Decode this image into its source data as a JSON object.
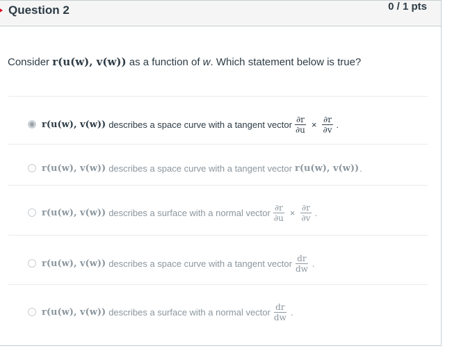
{
  "header": {
    "title": "Question 2",
    "points": "0 / 1 pts"
  },
  "question": {
    "prefix": "Consider",
    "function_expr": "r(u(w), v(w))",
    "suffix_pre": "as a function of",
    "variable": "w",
    "suffix_post": ". Which statement below is true?"
  },
  "options": [
    {
      "expr": "r(u(w), v(w))",
      "text": "describes a space curve with a tangent vector",
      "math_a_num": "∂r",
      "math_a_den": "∂u",
      "operator": "×",
      "math_b_num": "∂r",
      "math_b_den": "∂v",
      "end": "."
    },
    {
      "expr": "r(u(w), v(w))",
      "text": "describes a space curve with a tangent vector",
      "inline_math": "r(u(w), v(w))",
      "end": "."
    },
    {
      "expr": "r(u(w), v(w))",
      "text": "describes a surface with a normal vector",
      "math_a_num": "∂r",
      "math_a_den": "∂u",
      "operator": "×",
      "math_b_num": "∂r",
      "math_b_den": "∂v",
      "end": "."
    },
    {
      "expr": "r(u(w), v(w))",
      "text": "describes a space curve with a tangent vector",
      "math_a_num": "dr",
      "math_a_den": "dw",
      "end": "."
    },
    {
      "expr": "r(u(w), v(w))",
      "text": "describes a surface with a normal vector",
      "math_a_num": "dr",
      "math_a_den": "dw",
      "end": "."
    }
  ],
  "selected_option": 0,
  "colors": {
    "flag": "#e0061f",
    "text": "#2d3b45",
    "dim_text": "#8b969e",
    "header_bg": "#f5f5f5",
    "border": "#c7cdd1"
  }
}
